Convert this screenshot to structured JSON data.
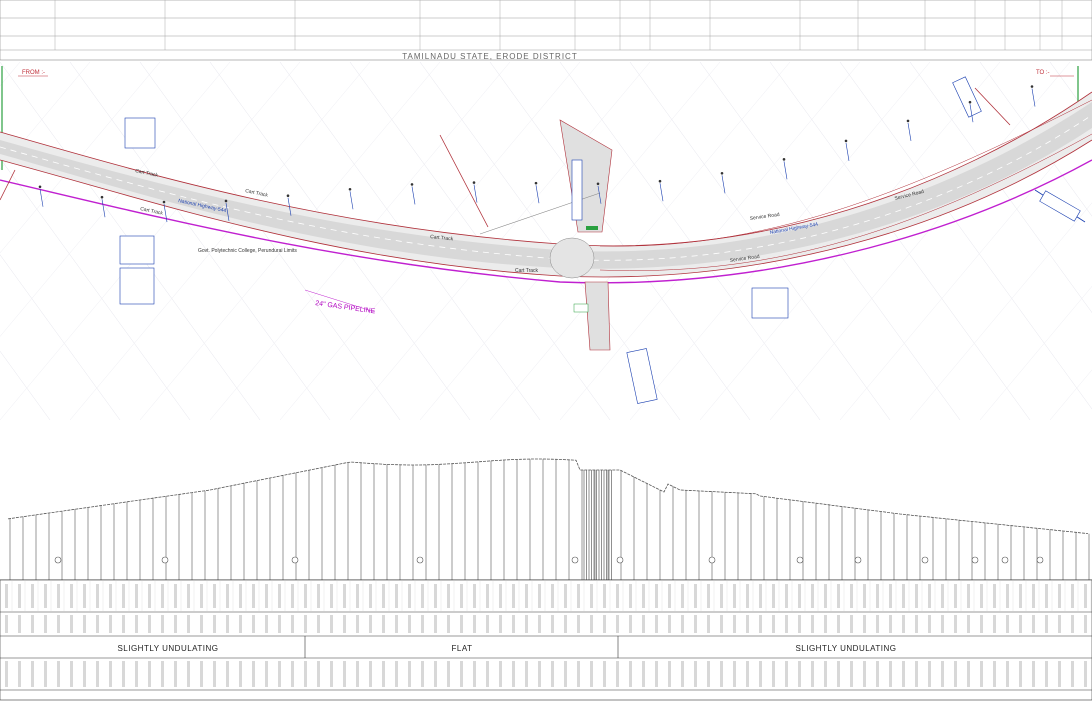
{
  "header": {
    "state_district": "TAMILNADU STATE, ERODE DISTRICT",
    "from_label": "FROM :-",
    "to_label": "TO :-"
  },
  "plan": {
    "highway_label_left": "National Highway-544",
    "highway_label_right": "National Highway-544",
    "gas_pipeline": "24\" GAS PIPELINE",
    "cart_tracks": [
      "Cart Track",
      "Cart Track",
      "Cart Track",
      "Cart Track",
      "Cart Track"
    ],
    "college_label": "Govt. Polytechnic College, Perundurai Limits",
    "service_road_labels": [
      "Service Road",
      "Service Road",
      "Service Road"
    ],
    "colors": {
      "carriageway": "#d8d8d8",
      "edge_line": "#b0303a",
      "pipeline": "#c020d0",
      "annotation_blue": "#1a3fb0",
      "grid": "#e4e4ec"
    }
  },
  "profile": {
    "terrain_segments": [
      "SLIGHTLY UNDULATING",
      "FLAT",
      "SLIGHTLY UNDULATING"
    ]
  }
}
